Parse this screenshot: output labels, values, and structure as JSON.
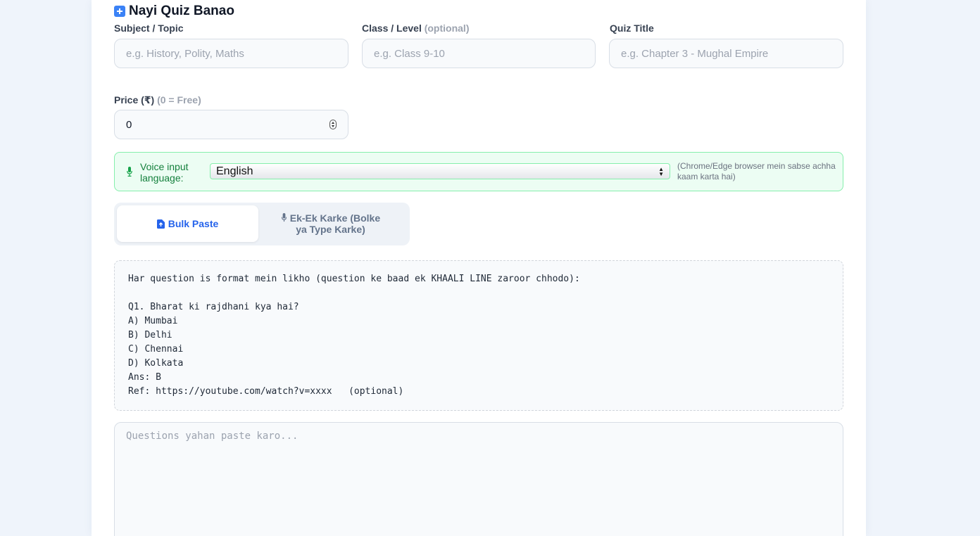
{
  "header": {
    "title": "Nayi Quiz Banao",
    "icon": "plus-square-icon"
  },
  "form": {
    "subject": {
      "label": "Subject / Topic",
      "placeholder": "e.g. History, Polity, Maths",
      "value": ""
    },
    "class_level": {
      "label": "Class / Level",
      "optional": "(optional)",
      "placeholder": "e.g. Class 9-10",
      "value": ""
    },
    "quiz_title": {
      "label": "Quiz Title",
      "placeholder": "e.g. Chapter 3 - Mughal Empire",
      "value": ""
    },
    "price": {
      "label": "Price (₹)",
      "hint": "(0 = Free)",
      "value": "0"
    }
  },
  "voice": {
    "label": "Voice input language:",
    "selected": "English",
    "hint": "(Chrome/Edge browser mein sabse achha kaam karta hai)",
    "accent": "#15803d"
  },
  "tabs": [
    {
      "label": "Bulk Paste",
      "icon": "file-upload-icon",
      "active": true
    },
    {
      "label": "Ek-Ek Karke (Bolke ya Type Karke)",
      "icon": "microphone-icon",
      "active": false
    }
  ],
  "format_instructions": "Har question is format mein likho (question ke baad ek KHAALI LINE zaroor chhodo):\n\nQ1. Bharat ki rajdhani kya hai?\nA) Mumbai\nB) Delhi\nC) Chennai\nD) Kolkata\nAns: B\nRef: https://youtube.com/watch?v=xxxx   (optional)",
  "paste": {
    "placeholder": "Questions yahan paste karo...",
    "value": ""
  },
  "colors": {
    "primary": "#2563eb",
    "background": "#eff4fb",
    "success_bg": "#ecfdf3"
  }
}
